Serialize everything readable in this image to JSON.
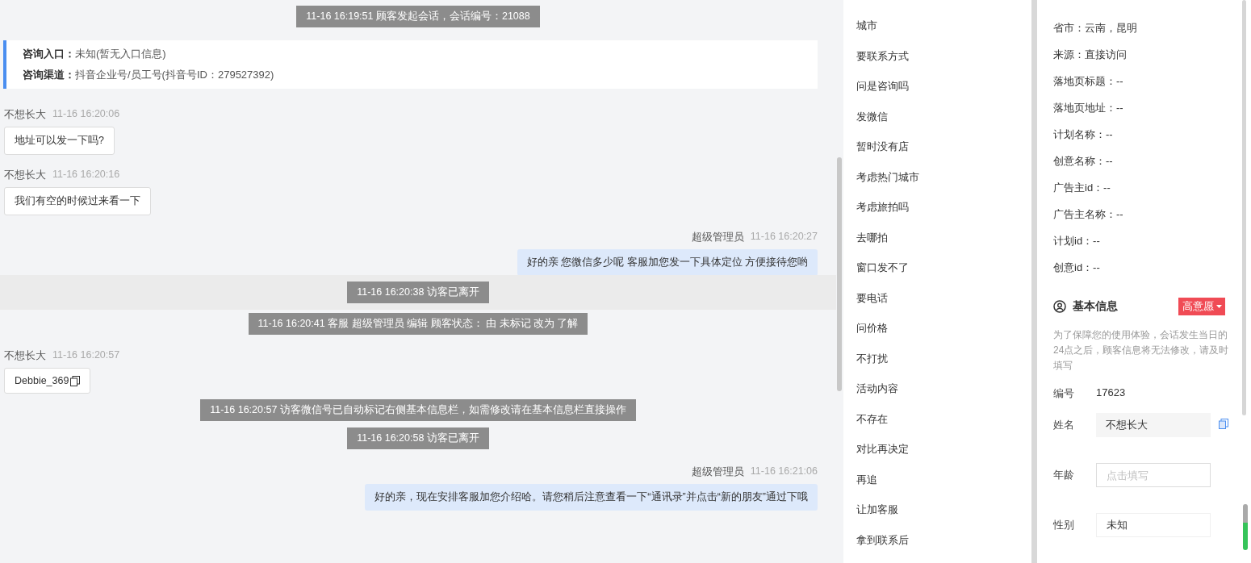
{
  "chat": {
    "messages": [
      {
        "kind": "system",
        "text": "11-16 16:19:51 顾客发起会话，会话编号：21088",
        "highlighted": false
      },
      {
        "kind": "info",
        "rows": [
          {
            "label": "咨询入口：",
            "value": "未知(暂无入口信息)"
          },
          {
            "label": "咨询渠道：",
            "value": "抖音企业号/员工号(抖音号ID：279527392)"
          }
        ]
      },
      {
        "kind": "customer",
        "name": "不想长大",
        "time": "11-16 16:20:06",
        "text": "地址可以发一下吗?",
        "copyable": false
      },
      {
        "kind": "customer",
        "name": "不想长大",
        "time": "11-16 16:20:16",
        "text": "我们有空的时候过来看一下",
        "copyable": false
      },
      {
        "kind": "agent",
        "name": "超级管理员",
        "time": "11-16 16:20:27",
        "text": "好的亲  您微信多少呢  客服加您发一下具体定位 方便接待您哟"
      },
      {
        "kind": "system",
        "text": "11-16 16:20:38 访客已离开",
        "highlighted": true
      },
      {
        "kind": "system",
        "text": "11-16 16:20:41 客服 超级管理员 编辑 顾客状态： 由 未标记 改为 了解",
        "highlighted": false
      },
      {
        "kind": "customer",
        "name": "不想长大",
        "time": "11-16 16:20:57",
        "text": "Debbie_369",
        "copyable": true
      },
      {
        "kind": "system",
        "text": "11-16 16:20:57 访客微信号已自动标记右侧基本信息栏，如需修改请在基本信息栏直接操作",
        "highlighted": false
      },
      {
        "kind": "system",
        "text": "11-16 16:20:58 访客已离开",
        "highlighted": false
      },
      {
        "kind": "agent",
        "name": "超级管理员",
        "time": "11-16 16:21:06",
        "text": "好的亲，现在安排客服加您介绍哈。请您稍后注意查看一下“通讯录”并点击“新的朋友”通过下哦"
      }
    ]
  },
  "quick_replies": [
    "城市",
    "要联系方式",
    "问是咨询吗",
    "发微信",
    "暂时没有店",
    "考虑热门城市",
    "考虑旅拍吗",
    "去哪拍",
    "窗口发不了",
    "要电话",
    "问价格",
    "不打扰",
    "活动内容",
    "不存在",
    "对比再决定",
    "再追",
    "让加客服",
    "拿到联系后"
  ],
  "visitor_info": [
    "省市：云南，昆明",
    "来源：直接访问",
    "落地页标题：--",
    "落地页地址：--",
    "计划名称：--",
    "创意名称：--",
    "广告主id：--",
    "广告主名称：--",
    "计划id：--",
    "创意id：--"
  ],
  "basic_info": {
    "title": "基本信息",
    "tag": "高意愿",
    "notice": "为了保障您的使用体验，会话发生当日的24点之后，顾客信息将无法修改，请及时填写",
    "id_label": "编号",
    "id_value": "17623",
    "fields": [
      {
        "label": "姓名",
        "kind": "filled",
        "value": "不想长大",
        "copyable": true
      },
      {
        "label": "年龄",
        "kind": "input",
        "placeholder": "点击填写"
      },
      {
        "label": "性别",
        "kind": "select",
        "value": "未知"
      }
    ]
  }
}
